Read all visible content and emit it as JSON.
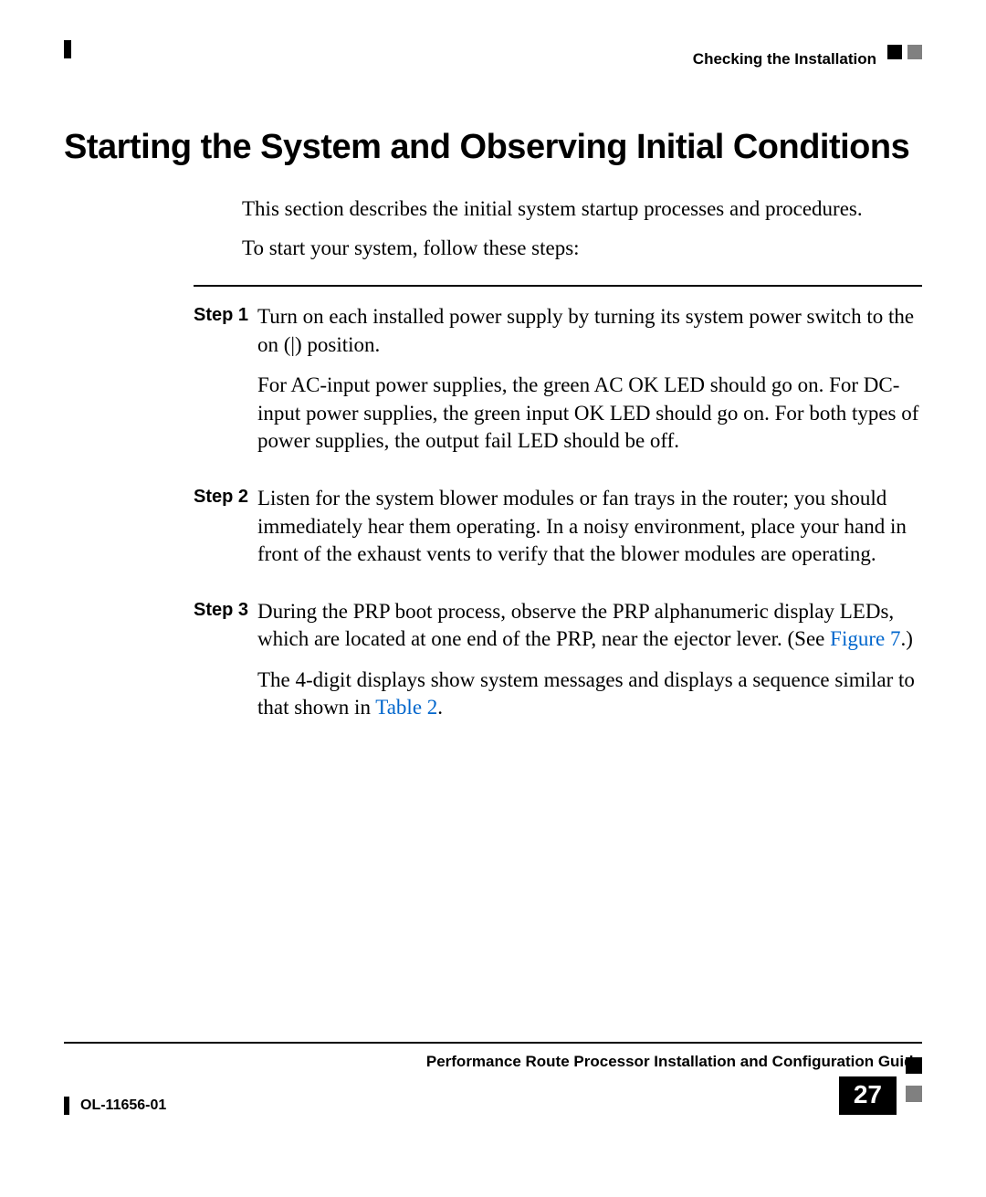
{
  "header": {
    "section_title": "Checking the Installation"
  },
  "heading": "Starting the System and Observing Initial Conditions",
  "intro": {
    "para1": "This section describes the initial system startup processes and procedures.",
    "para2": "To start your system, follow these steps:"
  },
  "steps": [
    {
      "label": "Step 1",
      "paras": [
        "Turn on each installed power supply by turning its system power switch to the on (|) position.",
        "For AC-input power supplies, the green AC OK LED should go on. For DC-input power supplies, the green input OK LED should go on. For both types of power supplies, the output fail LED should be off."
      ]
    },
    {
      "label": "Step 2",
      "paras": [
        "Listen for the system blower modules or fan trays in the router; you should immediately hear them operating. In a noisy environment, place your hand in front of the exhaust vents to verify that the blower modules are operating."
      ]
    },
    {
      "label": "Step 3",
      "para_a_prefix": "During the PRP boot process, observe the PRP alphanumeric display LEDs, which are located at one end of the PRP, near the ejector lever. (See ",
      "para_a_link": "Figure 7",
      "para_a_suffix": ".)",
      "para_b_prefix": "The 4-digit displays show system messages and displays a sequence similar to that shown in ",
      "para_b_link": "Table 2",
      "para_b_suffix": "."
    }
  ],
  "footer": {
    "guide_title": "Performance Route Processor Installation and Configuration Guide",
    "doc_id": "OL-11656-01",
    "page_number": "27"
  }
}
